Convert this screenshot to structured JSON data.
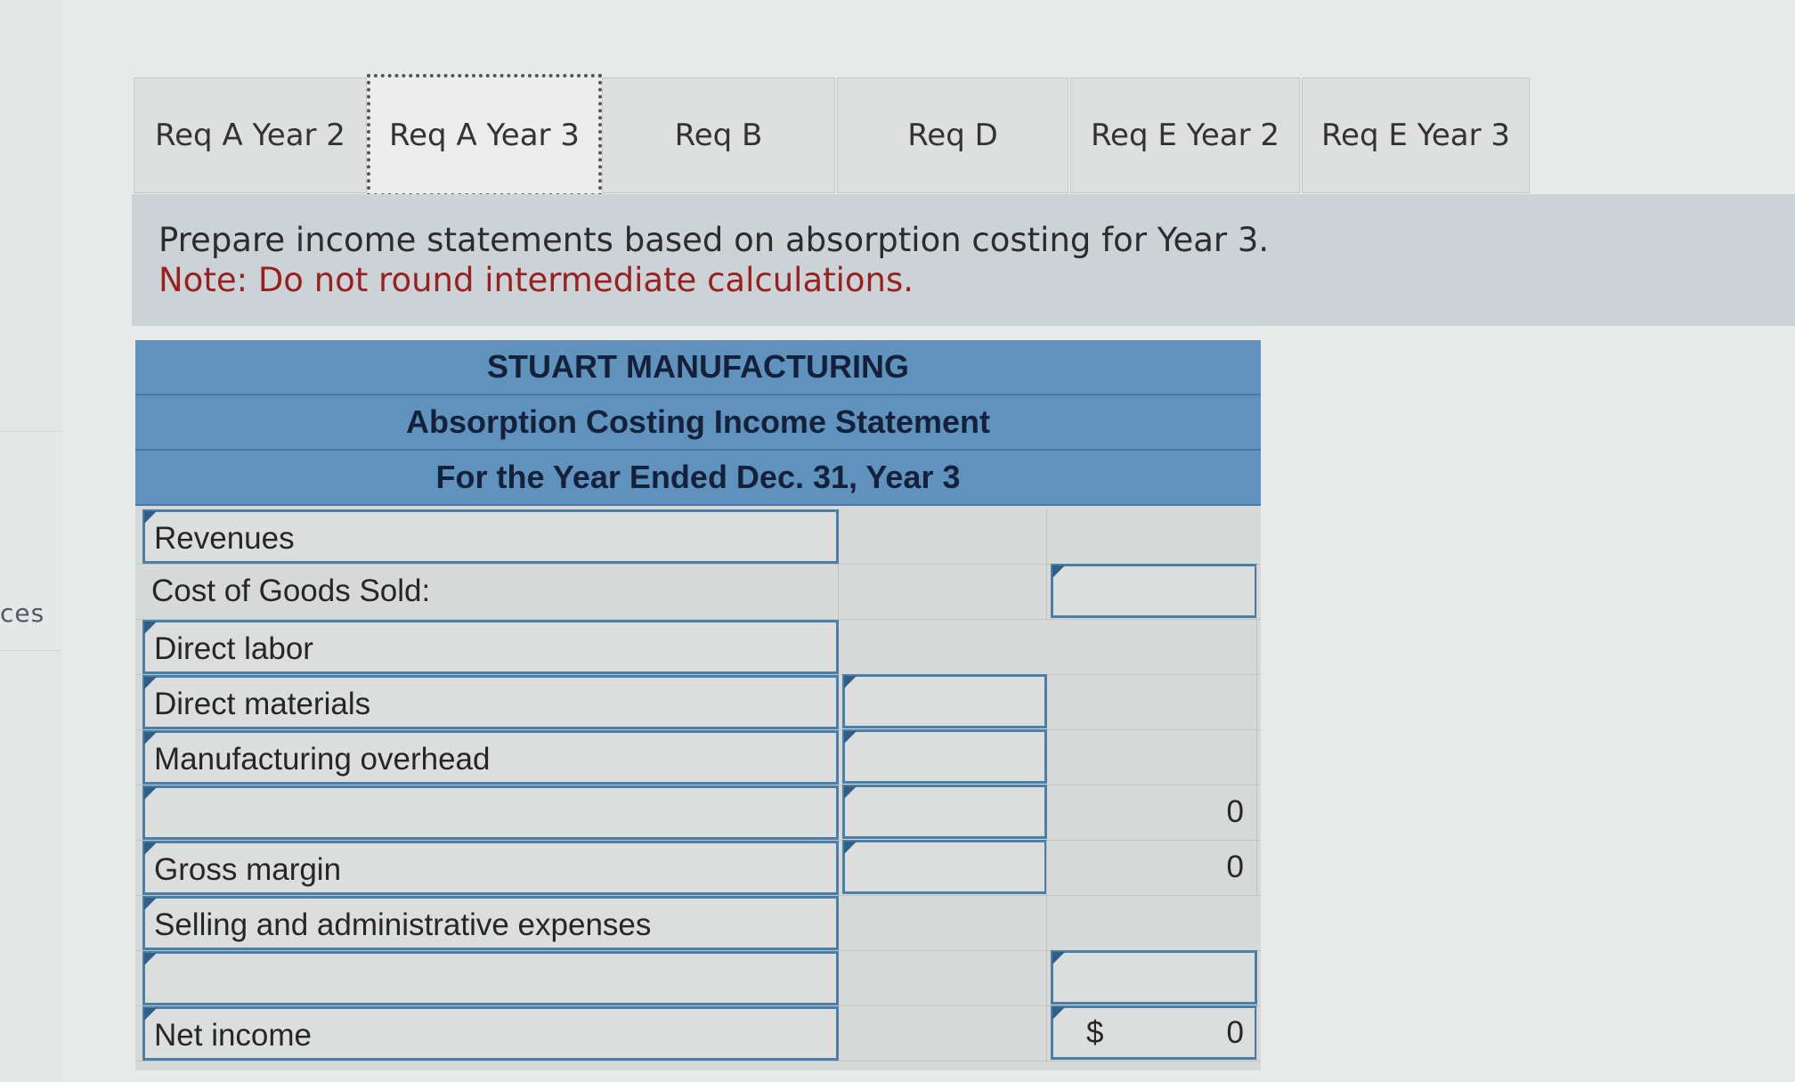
{
  "side_label": "ces",
  "tabs": [
    {
      "label": "Req A Year 2"
    },
    {
      "label": "Req A Year 3"
    },
    {
      "label": "Req B"
    },
    {
      "label": "Req D"
    },
    {
      "label": "Req E Year 2"
    },
    {
      "label": "Req E Year 3"
    }
  ],
  "instructions": {
    "text": "Prepare income statements based on absorption costing for Year 3.",
    "note": "Note: Do not round intermediate calculations."
  },
  "statement": {
    "company": "STUART MANUFACTURING",
    "title": "Absorption Costing Income Statement",
    "period": "For the Year Ended Dec. 31, Year 3",
    "rows": {
      "revenues": "Revenues",
      "cogs_header": "Cost of Goods Sold:",
      "direct_labor": "Direct labor",
      "direct_materials": "Direct materials",
      "manufacturing_overhead": "Manufacturing overhead",
      "blank_row_value": "0",
      "gross_margin": "Gross margin",
      "gross_margin_value": "0",
      "selling_admin": "Selling and administrative expenses",
      "net_income": "Net income",
      "net_income_currency": "$",
      "net_income_value": "0"
    }
  }
}
